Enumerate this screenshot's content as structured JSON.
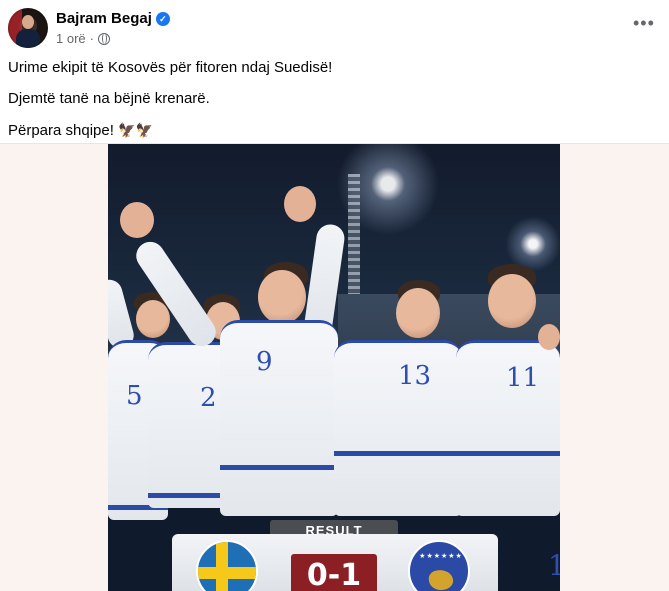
{
  "post": {
    "author_name": "Bajram Begaj",
    "verified_icon": "verified-badge-icon",
    "timestamp": "1 orë",
    "separator": "·",
    "audience_icon": "globe-icon",
    "more_icon": "ellipsis-icon",
    "more_label": "•••",
    "lines": [
      "Urime ekipit të Kosovës për fitoren ndaj Suedisë!",
      "Djemtë tanë na bëjnë krenarë.",
      "Përpara shqipe!"
    ],
    "emoji": "🦅🦅"
  },
  "photo": {
    "result_label": "RESULT",
    "score": "0-1",
    "home_flag": "sweden-flag",
    "away_flag": "kosovo-flag",
    "kosovo_stars": "★★★★★★",
    "jersey_numbers": [
      "5",
      "2",
      "9",
      "13",
      "11"
    ],
    "edge_number": "1",
    "colors": {
      "jersey": "#f5f7fa",
      "trim": "#2b4ba8",
      "score_box": "#8c1f24",
      "result_bar": "#4a4d52",
      "verified": "#1877f2"
    }
  }
}
